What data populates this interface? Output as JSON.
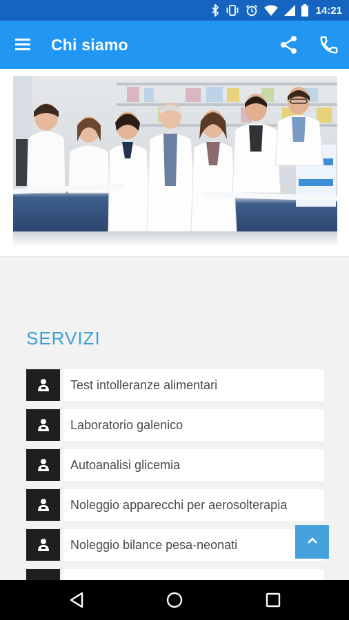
{
  "status_bar": {
    "time": "14:21",
    "icons": [
      "bluetooth-icon",
      "vibrate-icon",
      "alarm-icon",
      "wifi-icon",
      "signal-icon",
      "battery-icon"
    ]
  },
  "app_bar": {
    "title": "Chi siamo",
    "icons": [
      "menu-icon",
      "share-icon",
      "phone-icon"
    ]
  },
  "hero": {
    "image": "pharmacy-team-photo"
  },
  "services": {
    "heading": "SERVIZI",
    "items": [
      {
        "label": "Test intolleranze alimentari",
        "icon": "pharmacist-icon"
      },
      {
        "label": "Laboratorio galenico",
        "icon": "pharmacist-icon"
      },
      {
        "label": "Autoanalisi glicemia",
        "icon": "pharmacist-icon"
      },
      {
        "label": "Noleggio apparecchi per aerosolterapia",
        "icon": "pharmacist-icon"
      },
      {
        "label": "Noleggio bilance pesa-neonati",
        "icon": "pharmacist-icon"
      }
    ]
  },
  "scroll_top": {
    "icon": "chevron-up-icon"
  },
  "nav_bar": {
    "icons": [
      "back-icon",
      "home-icon",
      "recents-icon"
    ]
  },
  "colors": {
    "status_bar": "#1565c0",
    "app_bar": "#2196f3",
    "accent": "#3d9fd8",
    "service_icon_bg": "#1f1f1f",
    "background": "#f2f2f2"
  }
}
